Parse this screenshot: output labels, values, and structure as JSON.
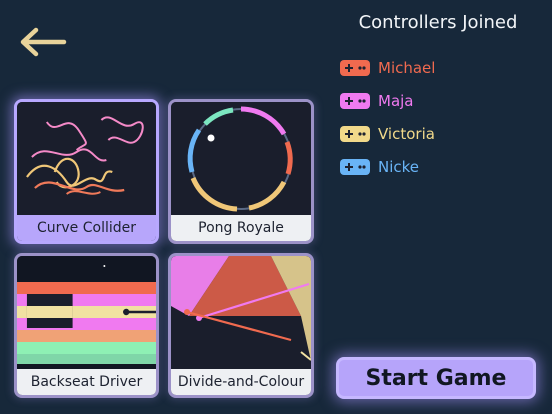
{
  "header": {
    "back_icon": "left-arrow-icon",
    "back_color": "#e8d39a"
  },
  "games": [
    {
      "label": "Curve Collider",
      "selected": true
    },
    {
      "label": "Pong Royale",
      "selected": false
    },
    {
      "label": "Backseat Driver",
      "selected": false
    },
    {
      "label": "Divide-and-Colour",
      "selected": false
    }
  ],
  "controllers": {
    "title": "Controllers Joined",
    "players": [
      {
        "name": "Michael",
        "color": "#f06a4f",
        "icon": "gamepad-icon"
      },
      {
        "name": "Maja",
        "color": "#f07af0",
        "icon": "gamepad-icon"
      },
      {
        "name": "Victoria",
        "color": "#f1d98a",
        "icon": "gamepad-icon"
      },
      {
        "name": "Nicke",
        "color": "#69b4f6",
        "icon": "gamepad-icon"
      }
    ]
  },
  "start_button": {
    "label": "Start Game"
  },
  "colors": {
    "accent": "#b6a4fa",
    "background": "#17283a"
  }
}
